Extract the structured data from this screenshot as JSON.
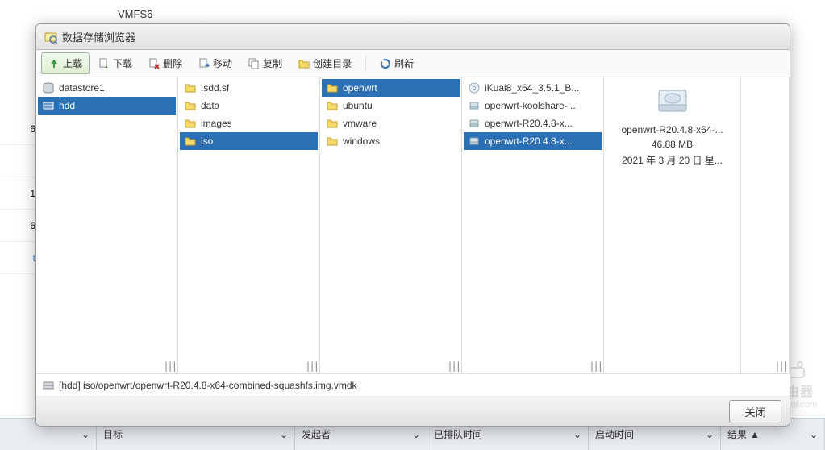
{
  "bg": {
    "vmfs": "VMFS6",
    "cols": [
      "目标",
      "发起者",
      "已排队时间",
      "启动时间",
      "结果"
    ],
    "rownums": [
      "6",
      "",
      "1",
      "6",
      "t"
    ]
  },
  "dialog": {
    "title": "数据存储浏览器"
  },
  "toolbar": {
    "upload": "上载",
    "download": "下载",
    "delete": "删除",
    "move": "移动",
    "copy": "复制",
    "mkdir": "创建目录",
    "refresh": "刷新"
  },
  "col1": {
    "items": [
      {
        "label": "datastore1",
        "icon": "datastore",
        "selected": false
      },
      {
        "label": "hdd",
        "icon": "hdd",
        "selected": true
      }
    ]
  },
  "col2": {
    "items": [
      {
        "label": ".sdd.sf",
        "icon": "folder",
        "selected": false
      },
      {
        "label": "data",
        "icon": "folder",
        "selected": false
      },
      {
        "label": "images",
        "icon": "folder",
        "selected": false
      },
      {
        "label": "iso",
        "icon": "folder",
        "selected": true
      }
    ]
  },
  "col3": {
    "items": [
      {
        "label": "openwrt",
        "icon": "folder",
        "selected": true
      },
      {
        "label": "ubuntu",
        "icon": "folder",
        "selected": false
      },
      {
        "label": "vmware",
        "icon": "folder",
        "selected": false
      },
      {
        "label": "windows",
        "icon": "folder",
        "selected": false
      }
    ]
  },
  "col4": {
    "items": [
      {
        "label": "iKuai8_x64_3.5.1_B...",
        "icon": "disc",
        "selected": false
      },
      {
        "label": "openwrt-koolshare-...",
        "icon": "disk",
        "selected": false
      },
      {
        "label": "openwrt-R20.4.8-x...",
        "icon": "disk",
        "selected": false
      },
      {
        "label": "openwrt-R20.4.8-x...",
        "icon": "disk",
        "selected": true
      }
    ]
  },
  "preview": {
    "name": "openwrt-R20.4.8-x64-...",
    "size": "46.88 MB",
    "date": "2021 年 3 月 20 日 星..."
  },
  "path": "[hdd] iso/openwrt/openwrt-R20.4.8-x64-combined-squashfs.img.vmdk",
  "footer": {
    "close": "关闭"
  },
  "watermark": {
    "top": "路由器",
    "bottom": "luyouqi.com"
  }
}
